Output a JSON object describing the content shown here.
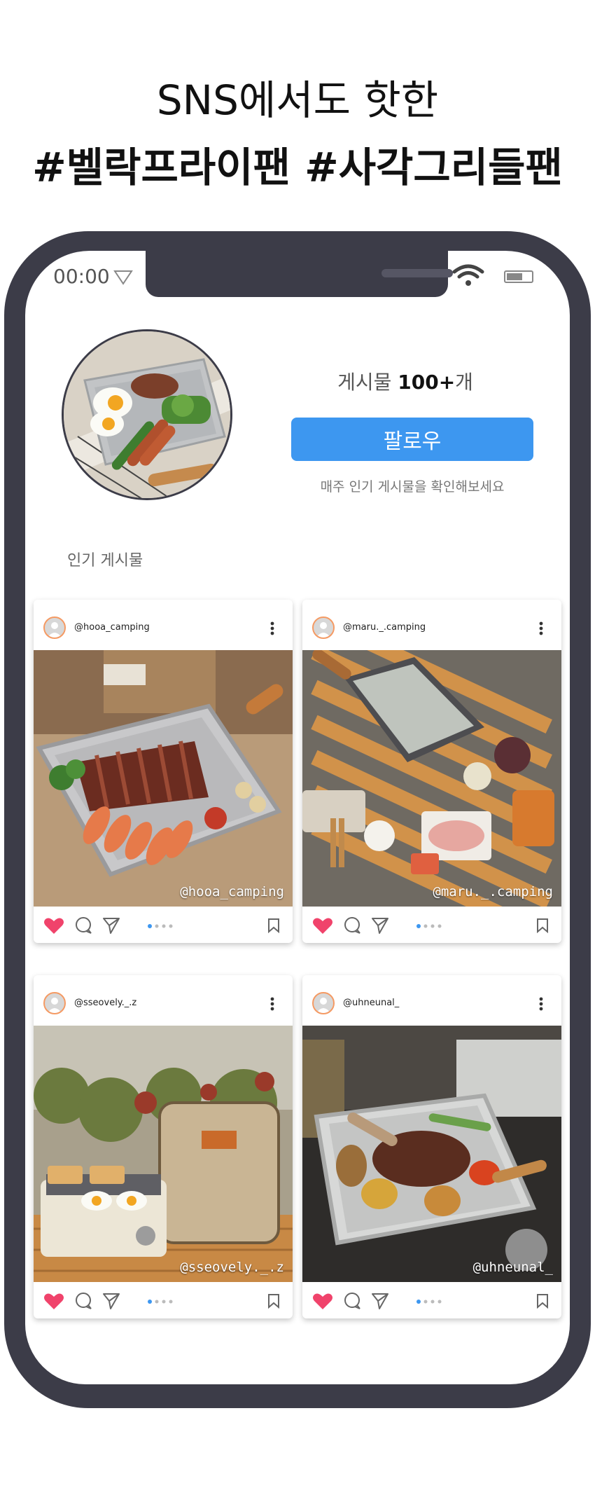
{
  "headline": {
    "line1": "SNS에서도 핫한",
    "line2": "#벨락프라이팬  #사각그리들팬"
  },
  "status_bar": {
    "time": "00:00"
  },
  "profile": {
    "posts_prefix": "게시물 ",
    "posts_count": "100+",
    "posts_suffix": "개",
    "follow_label": "팔로우",
    "follow_sub": "매주 인기 게시물을 확인해보세요"
  },
  "section": {
    "popular_label": "인기 게시물"
  },
  "posts": [
    {
      "username": "@hooa_camping",
      "watermark": "@hooa_camping"
    },
    {
      "username": "@maru._.camping",
      "watermark": "@maru._.camping"
    },
    {
      "username": "@sseovely._.z",
      "watermark": "@sseovely._.z"
    },
    {
      "username": "@uhneunal_",
      "watermark": "@uhneunal_"
    }
  ],
  "colors": {
    "frame": "#3c3c48",
    "accent": "#3d97f0",
    "heart": "#f0436b"
  },
  "icons": [
    "wifi-icon",
    "battery-icon",
    "signal-triangle-icon",
    "heart-icon",
    "comment-icon",
    "send-icon",
    "bookmark-icon",
    "more-icon"
  ]
}
